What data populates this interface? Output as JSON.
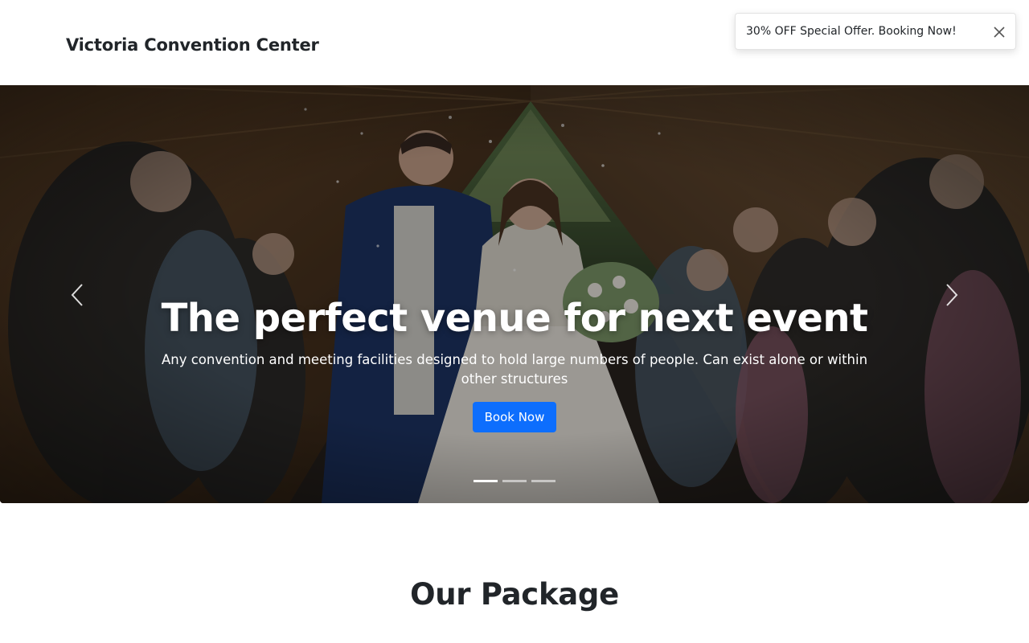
{
  "navbar": {
    "brand": "Victoria Convention Center"
  },
  "toast": {
    "message": "30% OFF Special Offer. Booking Now!",
    "close_icon": "close-icon"
  },
  "hero": {
    "title": "The perfect venue for next event",
    "subtitle": "Any convention and meeting facilities designed to hold large numbers of people. Can exist alone or within other structures",
    "button_label": "Book Now",
    "prev_icon": "chevron-left-icon",
    "next_icon": "chevron-right-icon",
    "slide_count": 3,
    "active_slide": 1,
    "accent_color": "#0d6efd"
  },
  "package": {
    "title": "Our Package"
  }
}
